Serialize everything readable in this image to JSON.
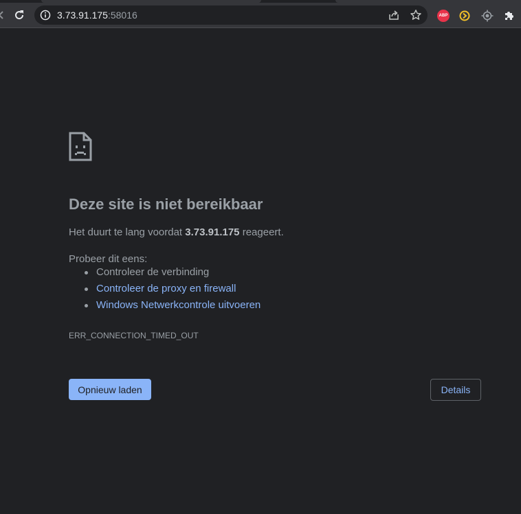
{
  "browser": {
    "url_host": "3.73.91.175",
    "url_port": ":58016",
    "extensions": {
      "adblock_label": "ABP"
    }
  },
  "error_page": {
    "title": "Deze site is niet bereikbaar",
    "desc_prefix": "Het duurt te lang voordat ",
    "desc_host": "3.73.91.175",
    "desc_suffix": " reageert.",
    "try_label": "Probeer dit eens:",
    "suggestions": [
      {
        "text": "Controleer de verbinding",
        "link": false
      },
      {
        "text": "Controleer de proxy en firewall",
        "link": true
      },
      {
        "text": "Windows Netwerkcontrole uitvoeren",
        "link": true
      }
    ],
    "error_code": "ERR_CONNECTION_TIMED_OUT",
    "reload_label": "Opnieuw laden",
    "details_label": "Details"
  },
  "colors": {
    "background": "#202124",
    "toolbar": "#35363a",
    "link": "#8ab4f8",
    "text": "#9aa0a6"
  }
}
